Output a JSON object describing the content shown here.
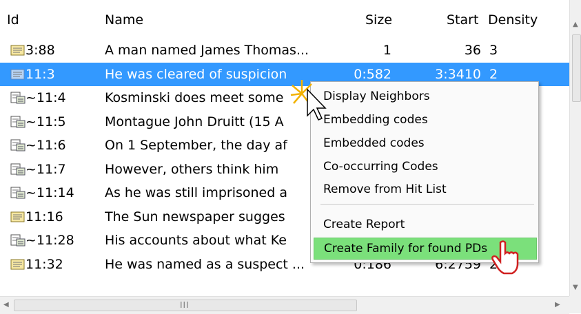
{
  "columns": {
    "id": "Id",
    "name": "Name",
    "size": "Size",
    "start": "Start",
    "density": "Density"
  },
  "rows": [
    {
      "id": "3:88",
      "name": "A man named James Thomas...",
      "size": "1",
      "start": "36",
      "density": "3",
      "icon": "quotation-icon"
    },
    {
      "id": "11:3",
      "name": "He was cleared of suspicion",
      "size": "0:582",
      "start": "3:3410",
      "density": "2",
      "icon": "quotation-icon",
      "selected": true
    },
    {
      "id": "~11:4",
      "name": "Kosminski does meet some",
      "size": "",
      "start": "",
      "density": "",
      "icon": "document-link-icon"
    },
    {
      "id": "~11:5",
      "name": "Montague John Druitt (15 A",
      "size": "",
      "start": "",
      "density": "",
      "icon": "document-link-icon"
    },
    {
      "id": "~11:6",
      "name": "On 1 September, the day af",
      "size": "",
      "start": "",
      "density": "",
      "icon": "document-link-icon"
    },
    {
      "id": "~11:7",
      "name": "However, others think him ",
      "size": "",
      "start": "",
      "density": "",
      "icon": "document-link-icon"
    },
    {
      "id": "~11:14",
      "name": "As he was still imprisoned a",
      "size": "",
      "start": "",
      "density": "",
      "icon": "document-link-icon"
    },
    {
      "id": "11:16",
      "name": "The Sun newspaper sugges",
      "size": "",
      "start": "",
      "density": "",
      "icon": "quotation-icon"
    },
    {
      "id": "~11:28",
      "name": "His accounts about what Ke",
      "size": "",
      "start": "",
      "density": "",
      "icon": "document-link-icon"
    },
    {
      "id": "11:32",
      "name": "He was named as a suspect ...",
      "size": "0:186",
      "start": "6:2759",
      "density": "2",
      "icon": "quotation-icon"
    }
  ],
  "context_menu": {
    "items": [
      "Display Neighbors",
      "Embedding codes",
      "Embedded codes",
      "Co-occurring Codes",
      "Remove from Hit List"
    ],
    "items2": [
      "Create Report",
      "Create Family for found PDs"
    ],
    "highlighted": "Create Family for found PDs"
  },
  "scrollbar": {
    "grip": "III"
  },
  "colors": {
    "selection": "#3399ff",
    "menu_highlight": "#7be07b"
  }
}
